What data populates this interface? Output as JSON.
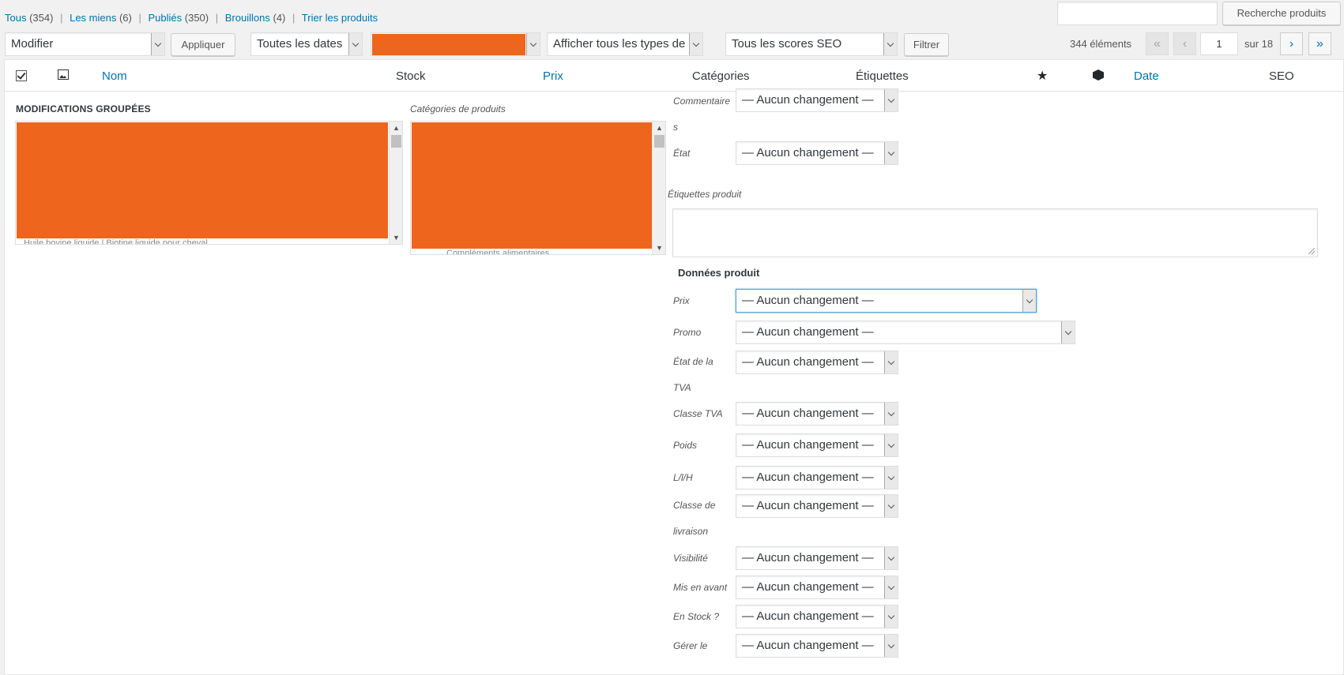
{
  "views": [
    {
      "label": "Tous",
      "count": "(354)"
    },
    {
      "label": "Les miens",
      "count": "(6)"
    },
    {
      "label": "Publiés",
      "count": "(350)"
    },
    {
      "label": "Brouillons",
      "count": "(4)"
    },
    {
      "label": "Trier les produits",
      "count": ""
    }
  ],
  "search": {
    "value": "",
    "button_label": "Recherche produits"
  },
  "filters": {
    "bulk_action": "Modifier",
    "apply_label": "Appliquer",
    "dates": "Toutes les dates",
    "category": "",
    "product_types": "Afficher tous les types de pro",
    "seo_scores": "Tous les scores SEO",
    "filter_label": "Filtrer"
  },
  "pagination": {
    "count_label": "344 éléments",
    "first": "«",
    "prev": "‹",
    "current": "1",
    "of_label": "sur 18",
    "next": "›",
    "last": "»"
  },
  "columns": {
    "name": "Nom",
    "stock": "Stock",
    "price": "Prix",
    "categories": "Catégories",
    "tags": "Étiquettes",
    "featured_icon": "★",
    "type_icon": "cube-icon",
    "date": "Date",
    "seo": "SEO"
  },
  "bulk_edit": {
    "title": "MODIFICATIONS GROUPÉES",
    "list_peek": "Huile bovine liquide | Biotine liquide pour cheval",
    "categories_title": "Catégories de produits",
    "cat_peek": "Compléments alimentaires",
    "tags_label": "Étiquettes produit",
    "product_data_title": "Données produit",
    "no_change": "— Aucun changement —",
    "fields": {
      "comments": {
        "line1": "Commentaire",
        "line2": "s"
      },
      "status": "État",
      "price": "Prix",
      "sale": "Promo",
      "tax_status": {
        "line1": "État de la",
        "line2": "TVA"
      },
      "tax_class": "Classe TVA",
      "weight": "Poids",
      "dimensions": "L/l/H",
      "shipping_class": {
        "line1": "Classe de",
        "line2": "livraison"
      },
      "visibility": "Visibilité",
      "featured": "Mis en avant",
      "in_stock": "En Stock ?",
      "manage": "Gérer le"
    }
  },
  "colors": {
    "redaction": "#ee651e",
    "link": "#0073aa",
    "background": "#f1f1f1"
  }
}
